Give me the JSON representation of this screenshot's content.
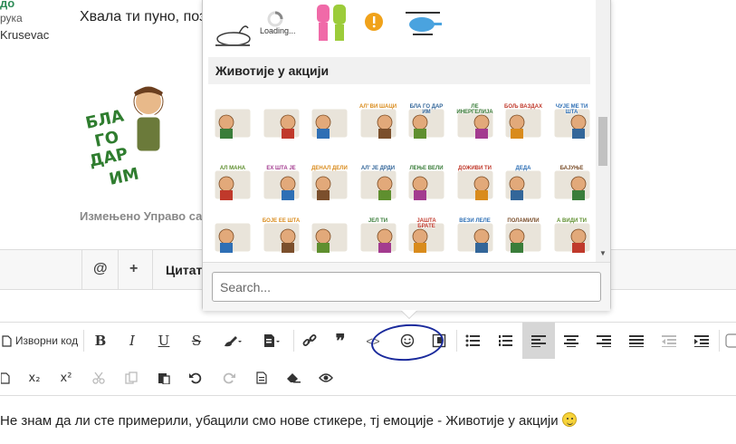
{
  "post": {
    "author_fragment": "до",
    "rank_fragment": "рука",
    "location_fragment": "Krusevac",
    "text_fragment": "Хвала ти пуно, поз",
    "edited_fragment": "Измењено Управо са",
    "big_sticker_lines": [
      "БЛА",
      "ГО",
      "ДАР",
      "ИМ"
    ]
  },
  "actions": {
    "mention_label": "@",
    "plus_label": "+",
    "quote_fragment": "Цитат"
  },
  "emoji_popup": {
    "loading_label": "Loading...",
    "section_title": "Животије у акцији",
    "search_placeholder": "Search...",
    "sticker_captions": {
      "row1": [
        "",
        "",
        "",
        "АЛ' ВИ ШАЦИ",
        "БЛА ГО ДАР ИМ",
        "ЛЕ ИНЕРГЕЛИЈА",
        "БОЉ ВАЗДАХ",
        "ЧУЈЕ МЕ ТИ ШТА"
      ],
      "row2": [
        "АЛ МАНА",
        "ЕХ ШТА ЈЕ",
        "ДЕНАЛ ДЕЛИ",
        "АЛ' ЈЕ ДРДИ",
        "ЛЕЊЕ ВЕЛИ",
        "ДОЖИВИ ТИ",
        "ДЕДА",
        "БАЈУЊЕ"
      ],
      "row3": [
        "",
        "БОЈЕ ЕЕ ШТА",
        "",
        "ЈЕЛ ТИ",
        "ЈАШТА БРАТЕ",
        "ВЕЗИ ЛЕЛЕ",
        "ПОЛАМИЛИ",
        "А ВИДИ ТИ"
      ]
    }
  },
  "toolbar": {
    "source_label": "Изворни код",
    "bold": "B",
    "italic": "I",
    "underline": "U",
    "strike": "S",
    "quote": "❞",
    "code": "<>",
    "subscript": "x₂",
    "superscript": "x²"
  },
  "editor": {
    "text": "Не знам да ли сте примерили, убацили смо нове стикере, тј емоције  - Животије у акцији"
  },
  "colors": {
    "accent_green": "#2e8b57",
    "annotation_blue": "#1a2a9c",
    "active_button": "#d6d6d6"
  }
}
